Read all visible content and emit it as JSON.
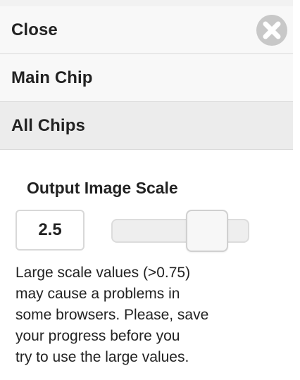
{
  "menu": {
    "items": [
      {
        "label": "Close",
        "icon": "close-icon",
        "has_close_button": true
      },
      {
        "label": "Main Chip",
        "active": false
      },
      {
        "label": "All Chips",
        "active": true
      }
    ]
  },
  "panel": {
    "title": "Output Image Scale",
    "scale_value": "2.5",
    "slider_level": 0.78,
    "warning_lines": [
      "Large scale values (>0.75)",
      "may cause a problems in",
      "some browsers. Please, save",
      "your progress before you",
      "try to use the large values."
    ]
  },
  "colors": {
    "menu_background": "#f8f8f8",
    "active_menu_background": "#ececec",
    "close_icon_background": "#c8c8c8",
    "text": "#222222"
  }
}
